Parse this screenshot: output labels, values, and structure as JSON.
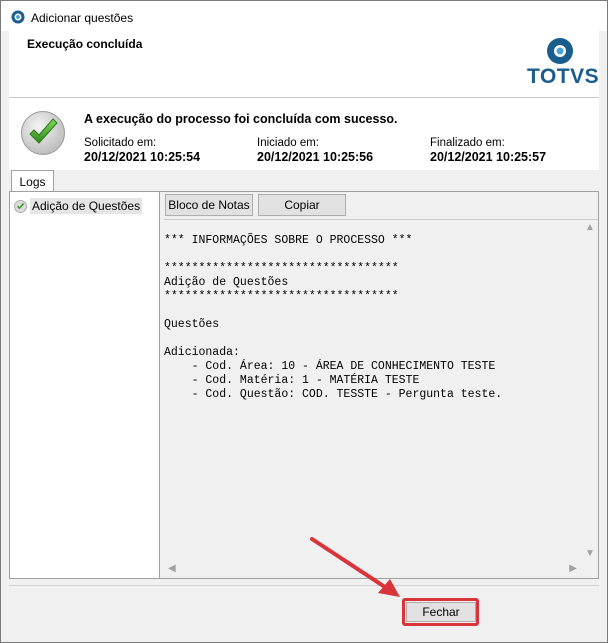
{
  "window": {
    "title": "Adicionar questões"
  },
  "header": {
    "title": "Execução concluída",
    "logo_text": "TOTVS"
  },
  "status": {
    "message": "A execução do processo foi concluída com sucesso.",
    "requested_label": "Solicitado em:",
    "requested_value": "20/12/2021 10:25:54",
    "started_label": "Iniciado em:",
    "started_value": "20/12/2021 10:25:56",
    "finished_label": "Finalizado em:",
    "finished_value": "20/12/2021 10:25:57"
  },
  "tabs": {
    "logs_label": "Logs"
  },
  "tree": {
    "items": [
      {
        "label": "Adição de Questões",
        "icon": "check-icon"
      }
    ]
  },
  "toolbar": {
    "notepad_label": "Bloco de Notas",
    "copy_label": "Copiar"
  },
  "log": {
    "text": "*** INFORMAÇÕES SOBRE O PROCESSO ***\n\n**********************************\nAdição de Questões\n**********************************\n\nQuestões\n\nAdicionada:\n    - Cod. Área: 10 - ÁREA DE CONHECIMENTO TESTE\n    - Cod. Matéria: 1 - MATÉRIA TESTE\n    - Cod. Questão: COD. TESSTE - Pergunta teste."
  },
  "footer": {
    "close_label": "Fechar"
  },
  "colors": {
    "brand": "#1a5d8c",
    "highlight": "#d9343a",
    "success": "#3a9a28"
  }
}
